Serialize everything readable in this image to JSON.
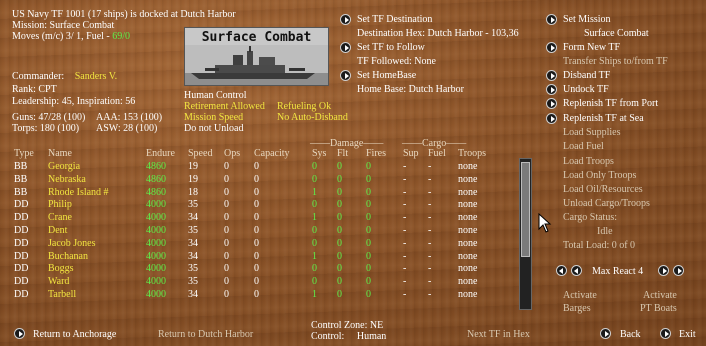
{
  "header": {
    "line1": "US Navy TF 1001 (17 ships) is docked at Dutch Harbor",
    "mission_label": "Mission:",
    "mission_value": "Surface Combat",
    "moves_label": "Moves (m/c)  3/ 1, Fuel -",
    "fuel_value": "69/0"
  },
  "portrait": {
    "title": "Surface Combat"
  },
  "tf_actions": {
    "set_destination": "Set TF Destination",
    "destination_hex": "Destination Hex: Dutch Harbor - 103,36",
    "set_follow": "Set TF to Follow",
    "tf_followed": "TF Followed: None",
    "set_homebase": "Set HomeBase",
    "home_base": "Home Base: Dutch Harbor"
  },
  "commander": {
    "label": "Commander:",
    "name": "Sanders V.",
    "rank": "Rank: CPT",
    "leadership": "Leadership: 45, Inspiration: 56",
    "guns": "Guns: 47/28 (100)",
    "aaa": "AAA: 153 (100)",
    "torps": "Torps: 180 (100)",
    "asw": "ASW: 28 (100)"
  },
  "control": {
    "human_control": "Human Control",
    "retirement": "Retirement Allowed",
    "refueling": "Refueling Ok",
    "mission_speed": "Mission Speed",
    "auto_disband": "No Auto-Disband",
    "unload": "Do not Unload"
  },
  "right_menu": {
    "set_mission": "Set Mission",
    "mission_value": "Surface Combat",
    "form_new": "Form New TF",
    "transfer": "Transfer Ships to/from TF",
    "disband": "Disband TF",
    "undock": "Undock TF",
    "replenish_port": "Replenish TF from Port",
    "replenish_sea": "Replenish TF at Sea",
    "load_supplies": "Load Supplies",
    "load_fuel": "Load Fuel",
    "load_troops": "Load Troops",
    "load_only_troops": "Load Only Troops",
    "load_oil": "Load Oil/Resources",
    "unload_cargo": "Unload Cargo/Troops",
    "cargo_status": "Cargo Status:",
    "cargo_idle": "Idle",
    "total_load": "Total Load: 0 of 0",
    "max_react": "Max React  4",
    "activate1": "Activate",
    "barges": "Barges",
    "activate2": "Activate",
    "pt_boats": "PT Boats"
  },
  "table": {
    "group_damage": "Damage",
    "group_cargo": "Cargo",
    "columns": [
      "Type",
      "Name",
      "Endure",
      "Speed",
      "Ops",
      "Capacity",
      "Sys",
      "Flt",
      "Fires",
      "Sup",
      "Fuel",
      "Troops"
    ],
    "rows": [
      {
        "type": "BB",
        "name": "Georgia",
        "endure": "4860",
        "speed": "19",
        "ops": "0",
        "cap": "0",
        "sys": "0",
        "flt": "0",
        "fires": "0",
        "sup": "-",
        "fuel": "-",
        "troops": "none"
      },
      {
        "type": "BB",
        "name": "Nebraska",
        "endure": "4860",
        "speed": "19",
        "ops": "0",
        "cap": "0",
        "sys": "0",
        "flt": "0",
        "fires": "0",
        "sup": "-",
        "fuel": "-",
        "troops": "none"
      },
      {
        "type": "BB",
        "name": "Rhode Island #",
        "endure": "4860",
        "speed": "18",
        "ops": "0",
        "cap": "0",
        "sys": "1",
        "flt": "0",
        "fires": "0",
        "sup": "-",
        "fuel": "-",
        "troops": "none"
      },
      {
        "type": "DD",
        "name": "Philip",
        "endure": "4000",
        "speed": "35",
        "ops": "0",
        "cap": "0",
        "sys": "0",
        "flt": "0",
        "fires": "0",
        "sup": "-",
        "fuel": "-",
        "troops": "none"
      },
      {
        "type": "DD",
        "name": "Crane",
        "endure": "4000",
        "speed": "34",
        "ops": "0",
        "cap": "0",
        "sys": "1",
        "flt": "0",
        "fires": "0",
        "sup": "-",
        "fuel": "-",
        "troops": "none"
      },
      {
        "type": "DD",
        "name": "Dent",
        "endure": "4000",
        "speed": "35",
        "ops": "0",
        "cap": "0",
        "sys": "0",
        "flt": "0",
        "fires": "0",
        "sup": "-",
        "fuel": "-",
        "troops": "none"
      },
      {
        "type": "DD",
        "name": "Jacob Jones",
        "endure": "4000",
        "speed": "34",
        "ops": "0",
        "cap": "0",
        "sys": "0",
        "flt": "0",
        "fires": "0",
        "sup": "-",
        "fuel": "-",
        "troops": "none"
      },
      {
        "type": "DD",
        "name": "Buchanan",
        "endure": "4000",
        "speed": "34",
        "ops": "0",
        "cap": "0",
        "sys": "1",
        "flt": "0",
        "fires": "0",
        "sup": "-",
        "fuel": "-",
        "troops": "none"
      },
      {
        "type": "DD",
        "name": "Boggs",
        "endure": "4000",
        "speed": "35",
        "ops": "0",
        "cap": "0",
        "sys": "0",
        "flt": "0",
        "fires": "0",
        "sup": "-",
        "fuel": "-",
        "troops": "none"
      },
      {
        "type": "DD",
        "name": "Ward",
        "endure": "4000",
        "speed": "35",
        "ops": "0",
        "cap": "0",
        "sys": "0",
        "flt": "0",
        "fires": "0",
        "sup": "-",
        "fuel": "-",
        "troops": "none"
      },
      {
        "type": "DD",
        "name": "Tarbell",
        "endure": "4000",
        "speed": "34",
        "ops": "0",
        "cap": "0",
        "sys": "1",
        "flt": "0",
        "fires": "0",
        "sup": "-",
        "fuel": "-",
        "troops": "none"
      }
    ]
  },
  "footer": {
    "return_anchorage": "Return to Anchorage",
    "return_dutch": "Return to Dutch Harbor",
    "control_zone": "Control Zone: NE",
    "control_label": "Control:",
    "control_value": "Human",
    "next_tf": "Next TF in Hex",
    "back": "Back",
    "exit": "Exit"
  },
  "colors": {
    "highlight": "#f2e640",
    "value_green": "#5ef04a",
    "background": "#8a5227"
  }
}
